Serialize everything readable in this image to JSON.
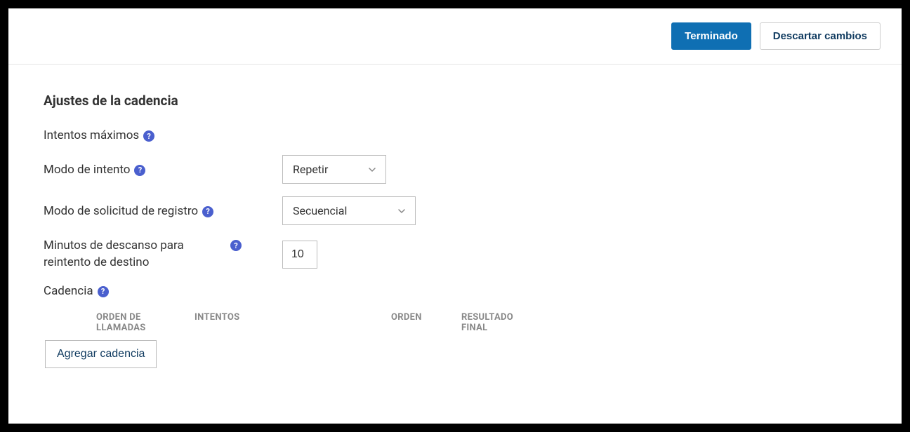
{
  "header": {
    "done_label": "Terminado",
    "discard_label": "Descartar cambios"
  },
  "section_title": "Ajustes de la cadencia",
  "fields": {
    "max_attempts_label": "Intentos máximos",
    "attempt_mode_label": "Modo de intento",
    "attempt_mode_value": "Repetir",
    "record_request_mode_label": "Modo de solicitud de registro",
    "record_request_mode_value": "Secuencial",
    "rest_minutes_label": "Minutos de descanso para reintento de destino",
    "rest_minutes_value": "10",
    "cadence_label": "Cadencia"
  },
  "table": {
    "col_call_order": "ORDEN DE LLAMADAS",
    "col_attempts": "INTENTOS",
    "col_order": "ORDEN",
    "col_final_result": "RESULTADO FINAL"
  },
  "add_cadence_label": "Agregar cadencia",
  "help_glyph": "?"
}
